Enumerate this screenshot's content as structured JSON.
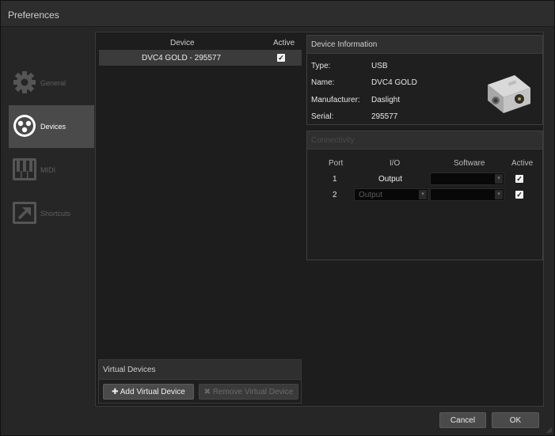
{
  "window": {
    "title": "Preferences"
  },
  "nav": {
    "items": [
      {
        "label": "General",
        "icon": "gear-icon"
      },
      {
        "label": "Devices",
        "icon": "xlr-connector-icon"
      },
      {
        "label": "MIDI",
        "icon": "piano-keys-icon"
      },
      {
        "label": "Shortcuts",
        "icon": "arrow-out-icon"
      }
    ],
    "active": "Devices"
  },
  "devices": {
    "header_device": "Device",
    "header_active": "Active",
    "rows": [
      {
        "name": "DVC4 GOLD - 295577",
        "active": true
      }
    ]
  },
  "device_info": {
    "title": "Device Information",
    "fields": [
      {
        "key": "Type:",
        "value": "USB"
      },
      {
        "key": "Name:",
        "value": "DVC4 GOLD"
      },
      {
        "key": "Manufacturer:",
        "value": "Daslight"
      },
      {
        "key": "Serial:",
        "value": "295577"
      }
    ]
  },
  "connectivity": {
    "title": "Connectivity",
    "headers": {
      "port": "Port",
      "io": "I/O",
      "software": "Software",
      "active": "Active"
    },
    "rows": [
      {
        "port": "1",
        "io": "Output",
        "software": "",
        "active": true
      },
      {
        "port": "2",
        "io": "Output",
        "software": "",
        "active": true
      }
    ]
  },
  "virtual_devices": {
    "title": "Virtual Devices",
    "add_label": "Add Virtual Device",
    "remove_label": "Remove Virtual Device"
  },
  "footer": {
    "cancel_label": "Cancel",
    "ok_label": "OK"
  },
  "colors": {
    "active_nav": "#4a4a4a",
    "window_bg": "#262626",
    "panel_bg": "#1d1d1d"
  }
}
